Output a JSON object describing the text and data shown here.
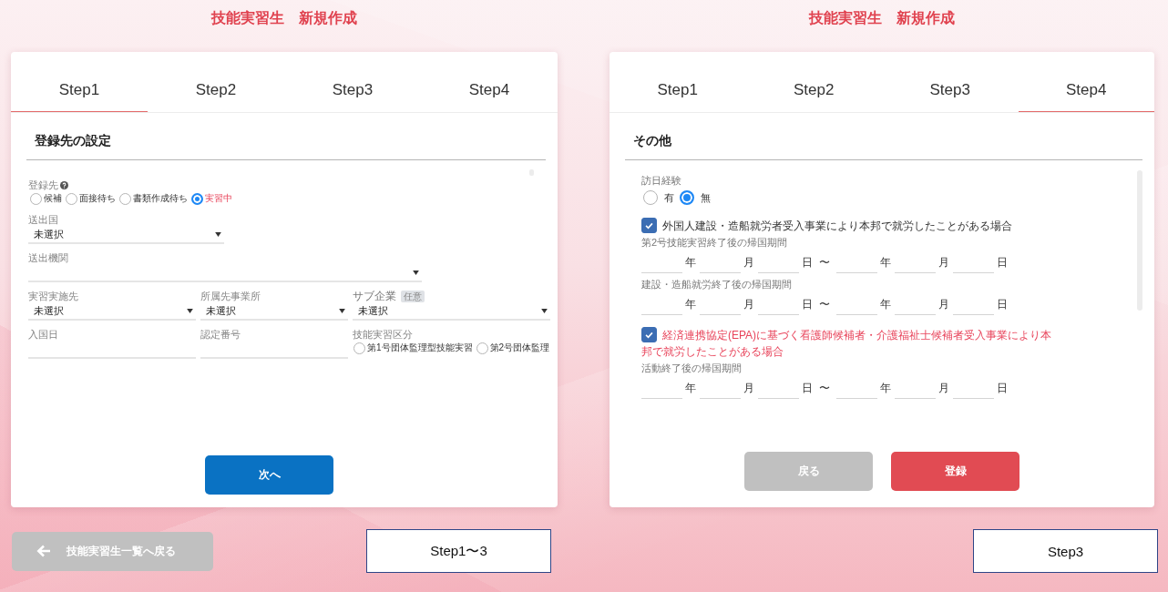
{
  "left": {
    "title": "技能実習生　新規作成",
    "tabs": [
      {
        "label": "Step1",
        "selected": true
      },
      {
        "label": "Step2",
        "selected": false
      },
      {
        "label": "Step3",
        "selected": false
      },
      {
        "label": "Step4",
        "selected": false
      }
    ],
    "section_title": "登録先の設定",
    "registration": {
      "label": "登録先",
      "help": true,
      "options": [
        {
          "label": "候補",
          "selected": false
        },
        {
          "label": "面接待ち",
          "selected": false
        },
        {
          "label": "書類作成待ち",
          "selected": false
        },
        {
          "label": "実習中",
          "selected": true
        }
      ]
    },
    "sending_country": {
      "label": "送出国",
      "value": "未選択"
    },
    "sending_agency": {
      "label": "送出機関"
    },
    "training_site": {
      "label": "実習実施先",
      "value": "未選択"
    },
    "affiliated_office": {
      "label": "所属先事業所",
      "value": "未選択"
    },
    "sub_company": {
      "label": "サブ企業",
      "badge": "任意",
      "value": "未選択"
    },
    "entry_date": {
      "label": "入国日"
    },
    "certification_number": {
      "label": "認定番号"
    },
    "training_category": {
      "label": "技能実習区分",
      "options": [
        {
          "label": "第1号団体監理型技能実習",
          "selected": false
        },
        {
          "label": "第2号団体監理",
          "selected": false
        }
      ]
    },
    "next_button": "次へ"
  },
  "right": {
    "title": "技能実習生　新規作成",
    "tabs": [
      {
        "label": "Step1",
        "selected": false
      },
      {
        "label": "Step2",
        "selected": false
      },
      {
        "label": "Step3",
        "selected": false
      },
      {
        "label": "Step4",
        "selected": true
      }
    ],
    "section_title": "その他",
    "visit_experience": {
      "label": "訪日経験",
      "options": [
        {
          "label": "有",
          "selected": false
        },
        {
          "label": "無",
          "selected": true
        }
      ]
    },
    "experiences": [
      {
        "label": "外国人建設・造船就労者受入事業により本邦で就労したことがある場合",
        "checked": true,
        "highlighted": false,
        "periods": [
          {
            "label": "第2号技能実習終了後の帰国期間",
            "from_units": [
              "年",
              "月",
              "日"
            ],
            "separator": "〜",
            "to_units": [
              "年",
              "月",
              "日"
            ]
          },
          {
            "label": "建設・造船就労終了後の帰国期間",
            "from_units": [
              "年",
              "月",
              "日"
            ],
            "separator": "〜",
            "to_units": [
              "年",
              "月",
              "日"
            ]
          }
        ]
      },
      {
        "label": "経済連携協定(EPA)に基づく看護師候補者・介護福祉士候補者受入事業により本邦で就労したことがある場合",
        "checked": true,
        "highlighted": true,
        "periods": [
          {
            "label": "活動終了後の帰国期間",
            "from_units": [
              "年",
              "月",
              "日"
            ],
            "separator": "〜",
            "to_units": [
              "年",
              "月",
              "日"
            ]
          }
        ]
      }
    ],
    "back_button": "戻る",
    "register_button": "登録"
  },
  "footer": {
    "back_to_list_button": "技能実習生一覧へ戻る",
    "left_caption": "Step1〜3",
    "right_caption": "Step3"
  }
}
